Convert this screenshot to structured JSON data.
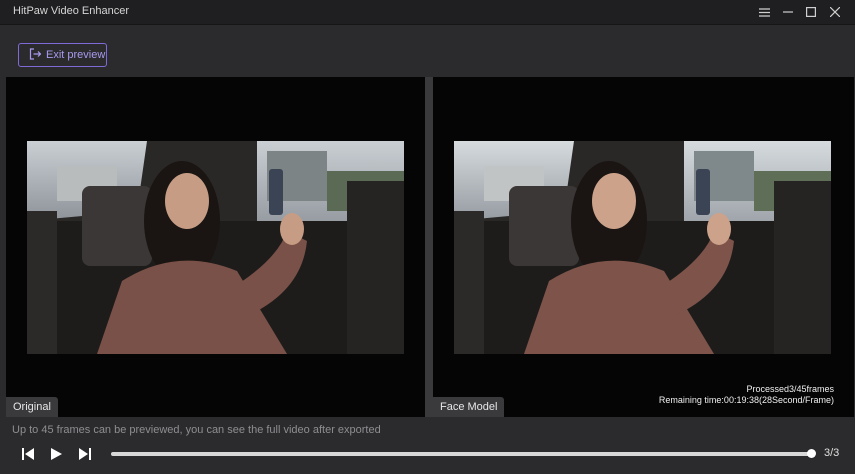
{
  "window": {
    "title": "HitPaw Video Enhancer",
    "controls": [
      "menu-icon",
      "minimize-icon",
      "maximize-icon",
      "close-icon"
    ]
  },
  "toolbar": {
    "exit_preview_label": "Exit preview",
    "exit_preview_icon": "exit-icon",
    "accent": "#7f6ad8"
  },
  "preview": {
    "left_label": "Original",
    "right_label": "Face Model",
    "processed_text": "Processed3/45frames",
    "remaining_text": "Remaining time:00:19:38(28Second/Frame)"
  },
  "footer": {
    "hint": "Up to 45 frames can be previewed, you can see the full video after exported",
    "counter": "3/3",
    "progress": 1.0,
    "buttons": [
      "previous-frame-icon",
      "play-icon",
      "next-frame-icon"
    ]
  }
}
